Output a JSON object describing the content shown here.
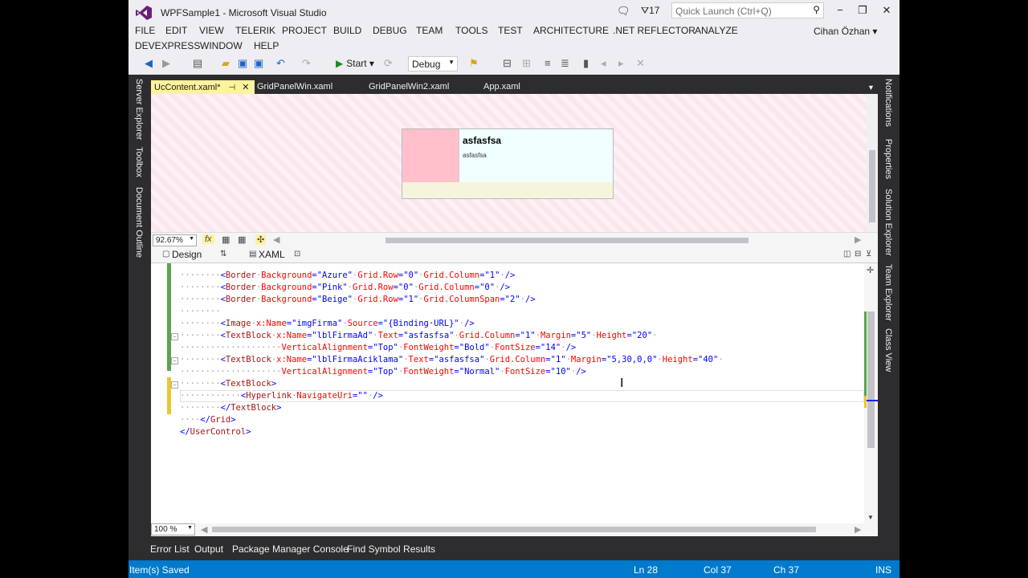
{
  "window": {
    "title": "WPFSample1 - Microsoft Visual Studio",
    "notification_count": "17",
    "quick_launch_placeholder": "Quick Launch (Ctrl+Q)",
    "user": "Cihan Özhan"
  },
  "menu": {
    "items": [
      "FILE",
      "EDIT",
      "VIEW",
      "TELERIK",
      "PROJECT",
      "BUILD",
      "DEBUG",
      "TEAM",
      "TOOLS",
      "TEST",
      "ARCHITECTURE",
      ".NET REFLECTOR",
      "ANALYZE",
      "DEVEXPRESS",
      "WINDOW",
      "HELP"
    ]
  },
  "toolbar": {
    "start_label": "Start",
    "config": "Debug"
  },
  "left_dock": [
    "Server Explorer",
    "Toolbox",
    "Document Outline"
  ],
  "right_dock": [
    "Notifications",
    "Properties",
    "Solution Explorer",
    "Team Explorer",
    "Class View"
  ],
  "tabs": [
    "UcContent.xaml*",
    "GridPanelWin.xaml",
    "GridPanelWin2.xaml",
    "App.xaml"
  ],
  "designer": {
    "preview_title": "asfasfsa",
    "preview_subtitle": "asfasfsa",
    "zoom": "92.67%",
    "fx_label": "fx"
  },
  "split": {
    "design_label": "Design",
    "xaml_label": "XAML"
  },
  "editor": {
    "zoom": "100 %"
  },
  "code_lines": [
    [
      [
        "dots",
        "········"
      ],
      [
        "br",
        "<"
      ],
      [
        "tag",
        "Border"
      ],
      [
        "dots",
        "·"
      ],
      [
        "at",
        "Background"
      ],
      [
        "br",
        "=\""
      ],
      [
        "val",
        "Azure"
      ],
      [
        "br",
        "\""
      ],
      [
        "dots",
        "·"
      ],
      [
        "at",
        "Grid.Row"
      ],
      [
        "br",
        "=\""
      ],
      [
        "val",
        "0"
      ],
      [
        "br",
        "\""
      ],
      [
        "dots",
        "·"
      ],
      [
        "at",
        "Grid.Column"
      ],
      [
        "br",
        "=\""
      ],
      [
        "val",
        "1"
      ],
      [
        "br",
        "\""
      ],
      [
        "dots",
        "·"
      ],
      [
        "br",
        "/>"
      ]
    ],
    [
      [
        "dots",
        "········"
      ],
      [
        "br",
        "<"
      ],
      [
        "tag",
        "Border"
      ],
      [
        "dots",
        "·"
      ],
      [
        "at",
        "Background"
      ],
      [
        "br",
        "=\""
      ],
      [
        "val",
        "Pink"
      ],
      [
        "br",
        "\""
      ],
      [
        "dots",
        "·"
      ],
      [
        "at",
        "Grid.Row"
      ],
      [
        "br",
        "=\""
      ],
      [
        "val",
        "0"
      ],
      [
        "br",
        "\""
      ],
      [
        "dots",
        "·"
      ],
      [
        "at",
        "Grid.Column"
      ],
      [
        "br",
        "=\""
      ],
      [
        "val",
        "0"
      ],
      [
        "br",
        "\""
      ],
      [
        "dots",
        "·"
      ],
      [
        "br",
        "/>"
      ]
    ],
    [
      [
        "dots",
        "········"
      ],
      [
        "br",
        "<"
      ],
      [
        "tag",
        "Border"
      ],
      [
        "dots",
        "·"
      ],
      [
        "at",
        "Background"
      ],
      [
        "br",
        "=\""
      ],
      [
        "val",
        "Beige"
      ],
      [
        "br",
        "\""
      ],
      [
        "dots",
        "·"
      ],
      [
        "at",
        "Grid.Row"
      ],
      [
        "br",
        "=\""
      ],
      [
        "val",
        "1"
      ],
      [
        "br",
        "\""
      ],
      [
        "dots",
        "·"
      ],
      [
        "at",
        "Grid.ColumnSpan"
      ],
      [
        "br",
        "=\""
      ],
      [
        "val",
        "2"
      ],
      [
        "br",
        "\""
      ],
      [
        "dots",
        "·"
      ],
      [
        "br",
        "/>"
      ]
    ],
    [
      [
        "dots",
        "········"
      ]
    ],
    [
      [
        "dots",
        "········"
      ],
      [
        "br",
        "<"
      ],
      [
        "tag",
        "Image"
      ],
      [
        "dots",
        "·"
      ],
      [
        "at",
        "x:Name"
      ],
      [
        "br",
        "=\""
      ],
      [
        "val",
        "imgFirma"
      ],
      [
        "br",
        "\""
      ],
      [
        "dots",
        "·"
      ],
      [
        "at",
        "Source"
      ],
      [
        "br",
        "=\""
      ],
      [
        "val",
        "{Binding·URL}"
      ],
      [
        "br",
        "\""
      ],
      [
        "dots",
        "·"
      ],
      [
        "br",
        "/>"
      ]
    ],
    [
      [
        "dots",
        "········"
      ],
      [
        "br",
        "<"
      ],
      [
        "tag",
        "TextBlock"
      ],
      [
        "dots",
        "·"
      ],
      [
        "at",
        "x:Name"
      ],
      [
        "br",
        "=\""
      ],
      [
        "val",
        "lblFirmaAd"
      ],
      [
        "br",
        "\""
      ],
      [
        "dots",
        "·"
      ],
      [
        "at",
        "Text"
      ],
      [
        "br",
        "=\""
      ],
      [
        "val",
        "asfasfsa"
      ],
      [
        "br",
        "\""
      ],
      [
        "dots",
        "·"
      ],
      [
        "at",
        "Grid.Column"
      ],
      [
        "br",
        "=\""
      ],
      [
        "val",
        "1"
      ],
      [
        "br",
        "\""
      ],
      [
        "dots",
        "·"
      ],
      [
        "at",
        "Margin"
      ],
      [
        "br",
        "=\""
      ],
      [
        "val",
        "5"
      ],
      [
        "br",
        "\""
      ],
      [
        "dots",
        "·"
      ],
      [
        "at",
        "Height"
      ],
      [
        "br",
        "=\""
      ],
      [
        "val",
        "20"
      ],
      [
        "br",
        "\""
      ],
      [
        "dots",
        "·"
      ]
    ],
    [
      [
        "dots",
        "····················"
      ],
      [
        "at",
        "VerticalAlignment"
      ],
      [
        "br",
        "=\""
      ],
      [
        "val",
        "Top"
      ],
      [
        "br",
        "\""
      ],
      [
        "dots",
        "·"
      ],
      [
        "at",
        "FontWeight"
      ],
      [
        "br",
        "=\""
      ],
      [
        "val",
        "Bold"
      ],
      [
        "br",
        "\""
      ],
      [
        "dots",
        "·"
      ],
      [
        "at",
        "FontSize"
      ],
      [
        "br",
        "=\""
      ],
      [
        "val",
        "14"
      ],
      [
        "br",
        "\""
      ],
      [
        "dots",
        "·"
      ],
      [
        "br",
        "/>"
      ]
    ],
    [
      [
        "dots",
        "········"
      ],
      [
        "br",
        "<"
      ],
      [
        "tag",
        "TextBlock"
      ],
      [
        "dots",
        "·"
      ],
      [
        "at",
        "x:Name"
      ],
      [
        "br",
        "=\""
      ],
      [
        "val",
        "lblFirmaAciklama"
      ],
      [
        "br",
        "\""
      ],
      [
        "dots",
        "·"
      ],
      [
        "at",
        "Text"
      ],
      [
        "br",
        "=\""
      ],
      [
        "val",
        "asfasfsa"
      ],
      [
        "br",
        "\""
      ],
      [
        "dots",
        "·"
      ],
      [
        "at",
        "Grid.Column"
      ],
      [
        "br",
        "=\""
      ],
      [
        "val",
        "1"
      ],
      [
        "br",
        "\""
      ],
      [
        "dots",
        "·"
      ],
      [
        "at",
        "Margin"
      ],
      [
        "br",
        "=\""
      ],
      [
        "val",
        "5,30,0,0"
      ],
      [
        "br",
        "\""
      ],
      [
        "dots",
        "·"
      ],
      [
        "at",
        "Height"
      ],
      [
        "br",
        "=\""
      ],
      [
        "val",
        "40"
      ],
      [
        "br",
        "\""
      ],
      [
        "dots",
        "·"
      ]
    ],
    [
      [
        "dots",
        "····················"
      ],
      [
        "at",
        "VerticalAlignment"
      ],
      [
        "br",
        "=\""
      ],
      [
        "val",
        "Top"
      ],
      [
        "br",
        "\""
      ],
      [
        "dots",
        "·"
      ],
      [
        "at",
        "FontWeight"
      ],
      [
        "br",
        "=\""
      ],
      [
        "val",
        "Normal"
      ],
      [
        "br",
        "\""
      ],
      [
        "dots",
        "·"
      ],
      [
        "at",
        "FontSize"
      ],
      [
        "br",
        "=\""
      ],
      [
        "val",
        "10"
      ],
      [
        "br",
        "\""
      ],
      [
        "dots",
        "·"
      ],
      [
        "br",
        "/>"
      ]
    ],
    [
      [
        "dots",
        "········"
      ],
      [
        "br",
        "<"
      ],
      [
        "tag",
        "TextBlock"
      ],
      [
        "br",
        ">"
      ]
    ],
    [
      [
        "dots",
        "············"
      ],
      [
        "br",
        "<"
      ],
      [
        "tag",
        "Hyperlink"
      ],
      [
        "dots",
        "·"
      ],
      [
        "at",
        "NavigateUri"
      ],
      [
        "br",
        "=\"\""
      ],
      [
        "dots",
        "·"
      ],
      [
        "br",
        "/>"
      ]
    ],
    [
      [
        "dots",
        "········"
      ],
      [
        "br",
        "</"
      ],
      [
        "tag",
        "TextBlock"
      ],
      [
        "br",
        ">"
      ]
    ],
    [
      [
        "dots",
        "····"
      ],
      [
        "br",
        "</"
      ],
      [
        "tag",
        "Grid"
      ],
      [
        "br",
        ">"
      ]
    ],
    [
      [
        "br",
        "</"
      ],
      [
        "tag",
        "UserControl"
      ],
      [
        "br",
        ">"
      ]
    ]
  ],
  "bottom_tabs": [
    "Error List",
    "Output",
    "Package Manager Console",
    "Find Symbol Results"
  ],
  "status": {
    "message": "Item(s) Saved",
    "ln": "Ln 28",
    "col": "Col 37",
    "ch": "Ch 37",
    "mode": "INS"
  }
}
